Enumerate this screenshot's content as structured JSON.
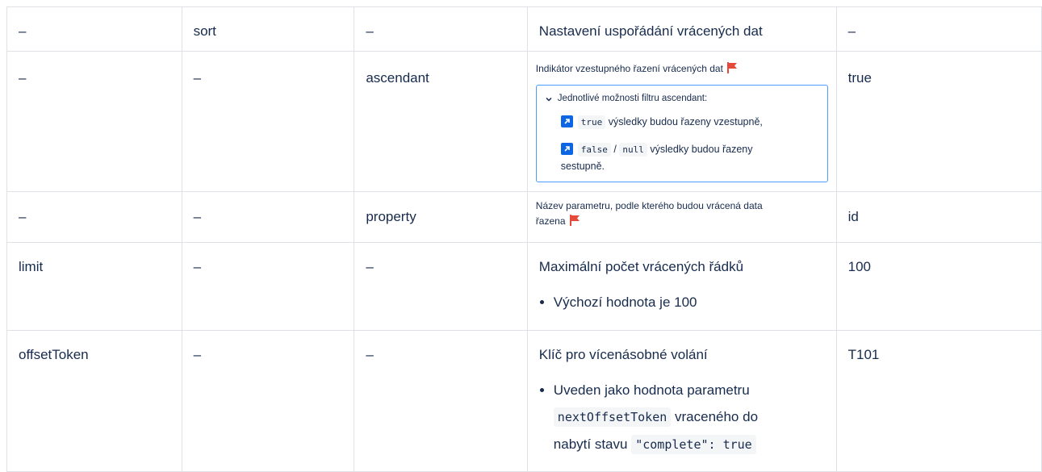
{
  "rows": [
    {
      "c1": "–",
      "c2": "sort",
      "c3": "–",
      "c4": {
        "text": "Nastavení uspořádání vrácených dat"
      },
      "c5": "–"
    },
    {
      "c1": "–",
      "c2": "–",
      "c3": "ascendant",
      "c4": {
        "text": "Indikátor vzestupného řazení vrácených dat",
        "expand_title": "Jednotlivé možnosti filtru ascendant:",
        "item1_code": "true",
        "item1_text": "výsledky budou řazeny vzestupně,",
        "item2_code_a": "false",
        "item2_sep": "/",
        "item2_code_b": "null",
        "item2_text_1": "výsledky budou řazeny",
        "item2_text_2": "sestupně."
      },
      "c5": "true"
    },
    {
      "c1": "–",
      "c2": "–",
      "c3": "property",
      "c4": {
        "text_1": "Název parametru, podle kterého budou vrácená data",
        "text_2": "řazena"
      },
      "c5": "id"
    },
    {
      "c1": "limit",
      "c2": "–",
      "c3": "–",
      "c4": {
        "text": "Maximální počet vrácených řádků",
        "bullet": "Výchozí hodnota je 100"
      },
      "c5": "100"
    },
    {
      "c1": "offsetToken",
      "c2": "–",
      "c3": "–",
      "c4": {
        "text": "Klíč pro vícenásobné volání",
        "bullet_1": "Uveden jako hodnota parametru",
        "bullet_code_1": "nextOffsetToken",
        "bullet_2": "vraceného do",
        "bullet_3": "nabytí stavu",
        "bullet_code_2": "\"complete\": true"
      },
      "c5": "T101"
    }
  ],
  "colors": {
    "flag": "#e5493a",
    "link_icon": "#0c66e4",
    "expand_border": "#4c9aff",
    "cell_border": "#dfe1e6"
  },
  "icons": {
    "flag": "flag-icon",
    "chevron": "chevron-down-icon",
    "link": "external-link-icon"
  }
}
